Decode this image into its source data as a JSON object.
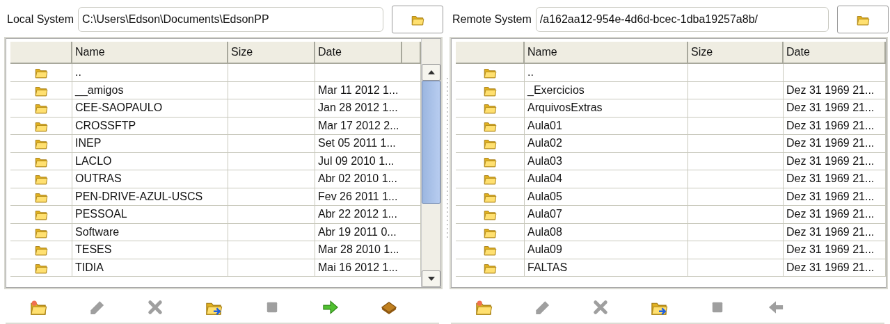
{
  "panels": [
    {
      "label": "Local System",
      "path": "C:\\Users\\Edson\\Documents\\EdsonPP",
      "scrollbar": true,
      "columns": [
        "Name",
        "Size",
        "Date"
      ],
      "rows": [
        {
          "name": ".."
        },
        {
          "name": "__amigos",
          "date": "Mar 11 2012 1..."
        },
        {
          "name": "CEE-SAOPAULO",
          "date": "Jan 28 2012 1..."
        },
        {
          "name": "CROSSFTP",
          "date": "Mar 17 2012 2..."
        },
        {
          "name": "INEP",
          "date": "Set 05 2011 1..."
        },
        {
          "name": "LACLO",
          "date": "Jul 09 2010 1..."
        },
        {
          "name": "OUTRAS",
          "date": "Abr 02 2010 1..."
        },
        {
          "name": "PEN-DRIVE-AZUL-USCS",
          "date": "Fev 26 2011 1..."
        },
        {
          "name": "PESSOAL",
          "date": "Abr 22 2012 1..."
        },
        {
          "name": "Software",
          "date": "Abr 19 2011 0..."
        },
        {
          "name": "TESES",
          "date": "Mar 28 2010 1..."
        },
        {
          "name": "TIDIA",
          "date": "Mai 16 2012 1..."
        }
      ],
      "tools": [
        {
          "kind": "new-folder",
          "disabled": false
        },
        {
          "kind": "edit",
          "disabled": true
        },
        {
          "kind": "delete",
          "disabled": true
        },
        {
          "kind": "refresh",
          "disabled": false
        },
        {
          "kind": "stop",
          "disabled": true
        },
        {
          "kind": "arrow-right",
          "disabled": false
        },
        {
          "kind": "package",
          "disabled": false
        }
      ]
    },
    {
      "label": "Remote System",
      "path": "/a162aa12-954e-4d6d-bcec-1dba19257a8b/",
      "scrollbar": false,
      "columns": [
        "Name",
        "Size",
        "Date"
      ],
      "rows": [
        {
          "name": ".."
        },
        {
          "name": "_Exercicios",
          "date": "Dez 31 1969 21..."
        },
        {
          "name": "ArquivosExtras",
          "date": "Dez 31 1969 21..."
        },
        {
          "name": "Aula01",
          "date": "Dez 31 1969 21..."
        },
        {
          "name": "Aula02",
          "date": "Dez 31 1969 21..."
        },
        {
          "name": "Aula03",
          "date": "Dez 31 1969 21..."
        },
        {
          "name": "Aula04",
          "date": "Dez 31 1969 21..."
        },
        {
          "name": "Aula05",
          "date": "Dez 31 1969 21..."
        },
        {
          "name": "Aula07",
          "date": "Dez 31 1969 21..."
        },
        {
          "name": "Aula08",
          "date": "Dez 31 1969 21..."
        },
        {
          "name": "Aula09",
          "date": "Dez 31 1969 21..."
        },
        {
          "name": "FALTAS",
          "date": "Dez 31 1969 21..."
        }
      ],
      "tools": [
        {
          "kind": "new-folder",
          "disabled": false
        },
        {
          "kind": "edit",
          "disabled": true
        },
        {
          "kind": "delete",
          "disabled": true
        },
        {
          "kind": "refresh",
          "disabled": false
        },
        {
          "kind": "stop",
          "disabled": true
        },
        {
          "kind": "arrow-left",
          "disabled": true
        }
      ]
    }
  ]
}
